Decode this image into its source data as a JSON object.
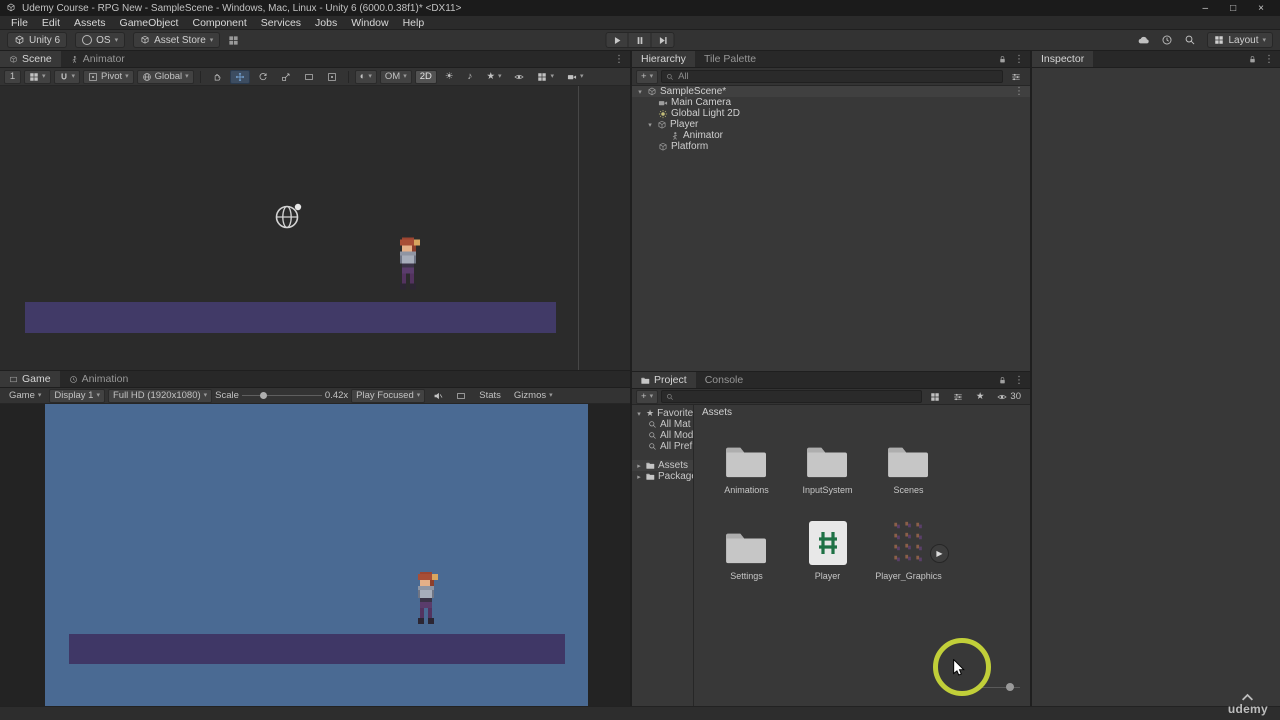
{
  "window": {
    "title": "Udemy Course - RPG New - SampleScene - Windows, Mac, Linux - Unity 6 (6000.0.38f1)* <DX11>",
    "minimize": "–",
    "maximize": "□",
    "close": "×"
  },
  "menus": [
    "File",
    "Edit",
    "Assets",
    "GameObject",
    "Component",
    "Services",
    "Jobs",
    "Window",
    "Help"
  ],
  "toolbar": {
    "unity_badge": "Unity 6",
    "account_label": "OS",
    "asset_store_label": "Asset Store",
    "layout_label": "Layout"
  },
  "glyphs": {
    "caret": "▾",
    "expander_open": "▾",
    "expander_closed": "▸",
    "menu": "⋮",
    "plus": "+",
    "star": "★",
    "half_sphere": "◐",
    "sun": "☀",
    "note": "♪",
    "play": "▶"
  },
  "scene": {
    "tabs": [
      "Scene",
      "Animator"
    ],
    "toolbar": {
      "tool_number": "1",
      "pivot": "Pivot",
      "global": "Global",
      "om": "OM",
      "two_d": "2D"
    }
  },
  "game": {
    "tabs": [
      "Game",
      "Animation"
    ],
    "toolbar": {
      "view": "Game",
      "display": "Display 1",
      "resolution": "Full HD (1920x1080)",
      "scale_label": "Scale",
      "scale_value": "0.42x",
      "play_focused": "Play Focused",
      "stats": "Stats",
      "gizmos": "Gizmos"
    }
  },
  "hierarchy": {
    "tabs": [
      "Hierarchy",
      "Tile Palette"
    ],
    "search_filter": "All",
    "items": [
      {
        "label": "SampleScene*"
      },
      {
        "label": "Main Camera"
      },
      {
        "label": "Global Light 2D"
      },
      {
        "label": "Player"
      },
      {
        "label": "Animator"
      },
      {
        "label": "Platform"
      }
    ]
  },
  "inspector": {
    "tab": "Inspector"
  },
  "project": {
    "tabs": [
      "Project",
      "Console"
    ],
    "favorites_label": "Favorites",
    "favorites": [
      "All Mat",
      "All Mod",
      "All Pref"
    ],
    "tree": [
      "Assets",
      "Packages"
    ],
    "breadcrumb": "Assets",
    "hidden_count": "30",
    "items": [
      {
        "name": "Animations",
        "type": "folder"
      },
      {
        "name": "InputSystem",
        "type": "folder"
      },
      {
        "name": "Scenes",
        "type": "folder"
      },
      {
        "name": "Settings",
        "type": "folder"
      },
      {
        "name": "Player",
        "type": "script"
      },
      {
        "name": "Player_Graphics",
        "type": "sprite"
      }
    ]
  },
  "watermark": "udemy",
  "colors": {
    "accent_selected_tool": "#7fb2e8",
    "highlight_ring": "#cddc39",
    "game_background": "#4a6a93",
    "platform": "#3f3766",
    "script_hash_green": "#1e7145"
  }
}
